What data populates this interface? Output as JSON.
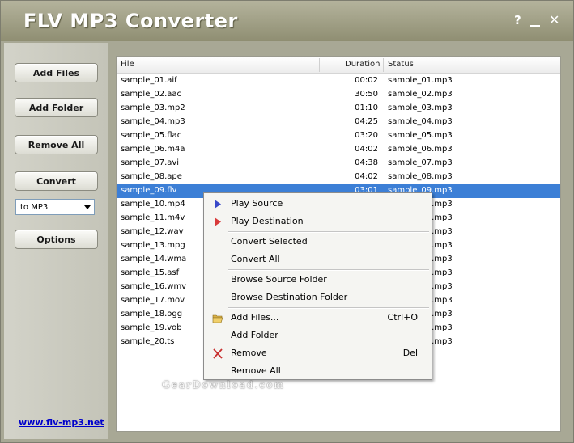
{
  "app": {
    "title": "FLV MP3 Converter"
  },
  "titlebar": {
    "help": "?",
    "close": "✕"
  },
  "sidebar": {
    "add_files": "Add Files",
    "add_folder": "Add Folder",
    "remove_all": "Remove All",
    "convert": "Convert",
    "format_selected": "to MP3",
    "options": "Options",
    "website": "www.flv-mp3.net"
  },
  "list": {
    "columns": {
      "file": "File",
      "duration": "Duration",
      "status": "Status"
    },
    "rows": [
      {
        "file": "sample_01.aif",
        "duration": "00:02",
        "status": "sample_01.mp3"
      },
      {
        "file": "sample_02.aac",
        "duration": "30:50",
        "status": "sample_02.mp3"
      },
      {
        "file": "sample_03.mp2",
        "duration": "01:10",
        "status": "sample_03.mp3"
      },
      {
        "file": "sample_04.mp3",
        "duration": "04:25",
        "status": "sample_04.mp3"
      },
      {
        "file": "sample_05.flac",
        "duration": "03:20",
        "status": "sample_05.mp3"
      },
      {
        "file": "sample_06.m4a",
        "duration": "04:02",
        "status": "sample_06.mp3"
      },
      {
        "file": "sample_07.avi",
        "duration": "04:38",
        "status": "sample_07.mp3"
      },
      {
        "file": "sample_08.ape",
        "duration": "04:02",
        "status": "sample_08.mp3"
      },
      {
        "file": "sample_09.flv",
        "duration": "03:01",
        "status": "sample_09.mp3"
      },
      {
        "file": "sample_10.mp4",
        "duration": "",
        "status": "sample_10.mp3"
      },
      {
        "file": "sample_11.m4v",
        "duration": "",
        "status": "sample_11.mp3"
      },
      {
        "file": "sample_12.wav",
        "duration": "",
        "status": "sample_12.mp3"
      },
      {
        "file": "sample_13.mpg",
        "duration": "",
        "status": "sample_13.mp3"
      },
      {
        "file": "sample_14.wma",
        "duration": "",
        "status": "sample_14.mp3"
      },
      {
        "file": "sample_15.asf",
        "duration": "",
        "status": "sample_15.mp3"
      },
      {
        "file": "sample_16.wmv",
        "duration": "",
        "status": "sample_16.mp3"
      },
      {
        "file": "sample_17.mov",
        "duration": "",
        "status": "sample_17.mp3"
      },
      {
        "file": "sample_18.ogg",
        "duration": "",
        "status": "sample_18.mp3"
      },
      {
        "file": "sample_19.vob",
        "duration": "",
        "status": "sample_19.mp3"
      },
      {
        "file": "sample_20.ts",
        "duration": "",
        "status": "sample_20.mp3"
      }
    ],
    "selected_index": 8
  },
  "context_menu": {
    "play_source": "Play Source",
    "play_destination": "Play Destination",
    "convert_selected": "Convert Selected",
    "convert_all": "Convert All",
    "browse_source": "Browse Source Folder",
    "browse_destination": "Browse Destination Folder",
    "add_files": "Add Files...",
    "add_files_shortcut": "Ctrl+O",
    "add_folder": "Add Folder",
    "remove": "Remove",
    "remove_shortcut": "Del",
    "remove_all": "Remove All"
  },
  "watermark": "GearDownload.com",
  "colors": {
    "accent": "#3c7fd6",
    "titlebar": "#a3a287",
    "link": "#0000cc"
  }
}
